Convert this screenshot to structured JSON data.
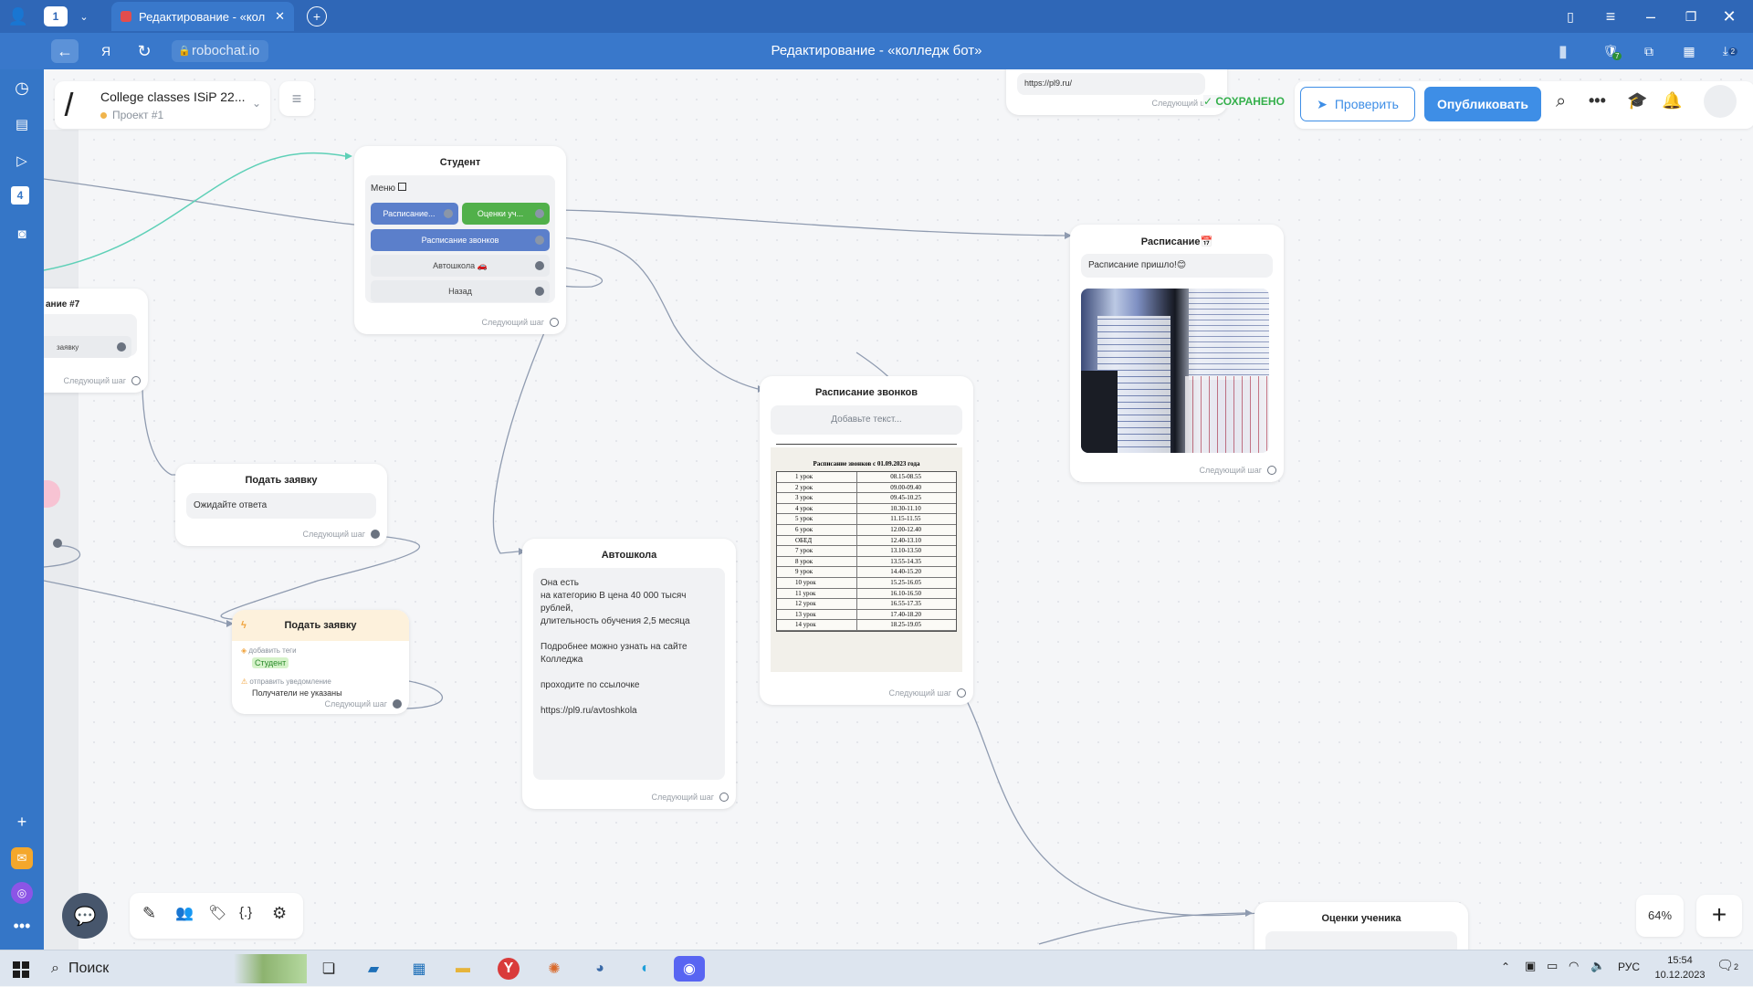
{
  "browser": {
    "tab_count": "1",
    "tab_title": "Редактирование - «кол",
    "address": "robochat.io",
    "page_title": "Редактирование - «колледж бот»",
    "notif_badge": "2",
    "ext_badge": "7"
  },
  "project": {
    "name": "College classes ISiP 22...",
    "sub": "Проект #1"
  },
  "header": {
    "saved": "СОХРАНЕНО",
    "check": "Проверить",
    "publish": "Опубликовать"
  },
  "top_partial": {
    "link": "https://pl9.ru/",
    "next": "Следующий шаг"
  },
  "nodes": {
    "student": {
      "title": "Студент",
      "menu": "Меню",
      "b1": "Расписание...",
      "b2": "Оценки уч...",
      "b3": "Расписание звонков",
      "b4": "Автошкола 🚗",
      "b5": "Назад",
      "next": "Следующий шаг"
    },
    "left_partial": {
      "title": "ание #7",
      "btn": "заявку",
      "next": "Следующий шаг"
    },
    "apply1": {
      "title": "Подать заявку",
      "text": "Ожидайте ответа",
      "next": "Следующий шаг"
    },
    "apply2": {
      "title": "Подать заявку",
      "act1": "добавить теги",
      "tag": "Студент",
      "act2": "отправить уведомление",
      "recipients": "Получатели не указаны",
      "next": "Следующий шаг"
    },
    "autoschool": {
      "title": "Автошкола",
      "l1": "Она есть",
      "l2": "на категорию В цена 40 000 тысяч рублей,",
      "l3": "длительность обучения 2,5 месяца",
      "l4": "Подробнее можно узнать на сайте",
      "l5": "Колледжа",
      "l6": "проходите по ссылочке",
      "l7": "https://pl9.ru/avtoshkola",
      "next": "Следующий шаг"
    },
    "bells": {
      "title": "Расписание звонков",
      "placeholder": "Добавьте текст...",
      "doc_title": "Расписание звонков с 01.09.2023 года",
      "next": "Следующий шаг"
    },
    "schedule": {
      "title": "Расписание📅",
      "text": "Расписание пришло!😊",
      "next": "Следующий шаг"
    },
    "grades": {
      "title": "Оценки ученика"
    }
  },
  "bells_table": [
    [
      "1 урок",
      "08.15-08.55"
    ],
    [
      "2 урок",
      "09.00-09.40"
    ],
    [
      "3 урок",
      "09.45-10.25"
    ],
    [
      "4 урок",
      "10.30-11.10"
    ],
    [
      "5 урок",
      "11.15-11.55"
    ],
    [
      "6 урок",
      "12.00-12.40"
    ],
    [
      "ОБЕД",
      "12.40-13.10"
    ],
    [
      "7 урок",
      "13.10-13.50"
    ],
    [
      "8 урок",
      "13.55-14.35"
    ],
    [
      "9 урок",
      "14.40-15.20"
    ],
    [
      "10 урок",
      "15.25-16.05"
    ],
    [
      "11 урок",
      "16.10-16.50"
    ],
    [
      "12 урок",
      "16.55-17.35"
    ],
    [
      "13 урок",
      "17.40-18.20"
    ],
    [
      "14 урок",
      "18.25-19.05"
    ]
  ],
  "zoom": "64%",
  "taskbar": {
    "search": "Поиск",
    "lang": "РУС",
    "time": "15:54",
    "date": "10.12.2023",
    "notif": "2"
  },
  "colors": {
    "accent": "#3e8ee6",
    "browser": "#2f67b7",
    "btn_blue": "#5b7fcb",
    "btn_green": "#51b04a",
    "saved": "#35b04c"
  }
}
